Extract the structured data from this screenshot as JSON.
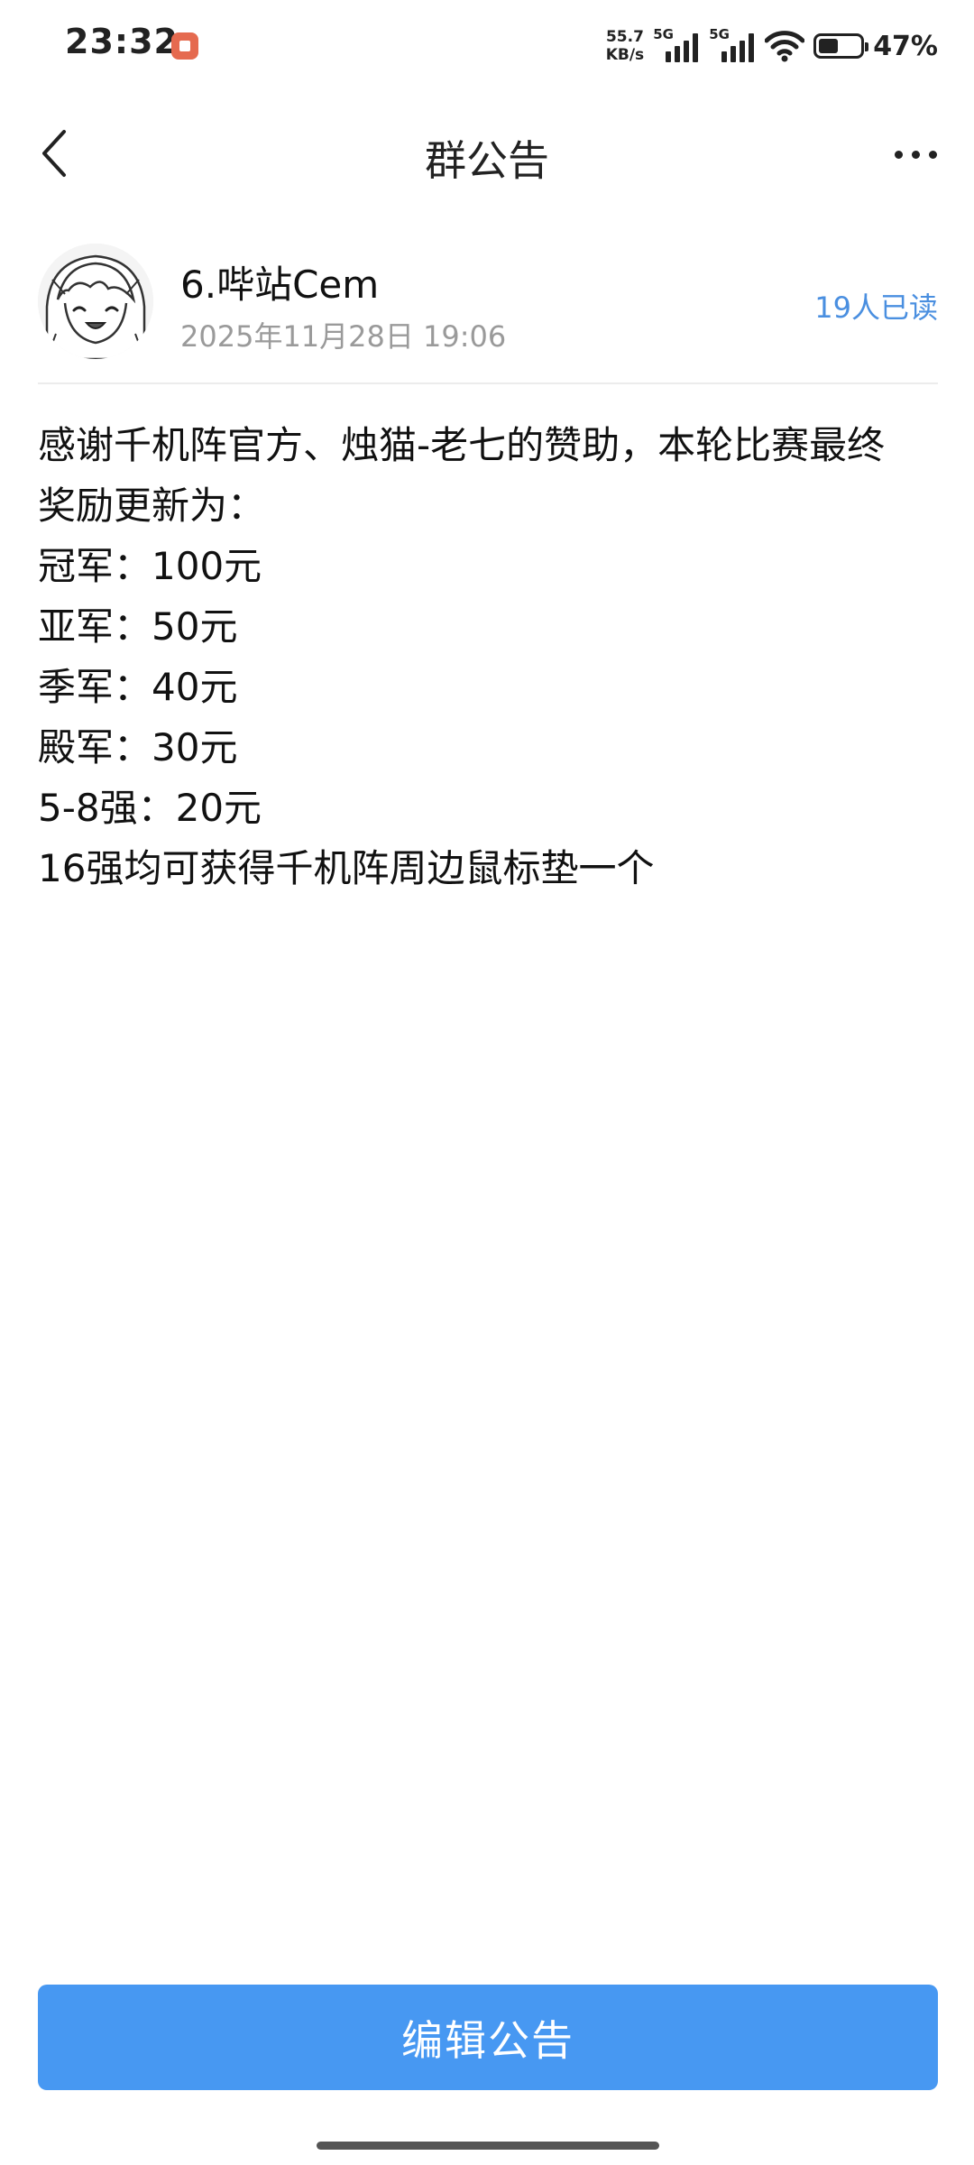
{
  "status_bar": {
    "time": "23:32",
    "net_speed_value": "55.7",
    "net_speed_unit": "KB/s",
    "signal1_label": "5G",
    "signal2_label": "5G",
    "battery_percent": "47%",
    "battery_level": 0.47,
    "notification_icon": "app-notification-icon"
  },
  "nav": {
    "back_icon": "chevron-left-icon",
    "title": "群公告",
    "more_icon": "more-horizontal-icon"
  },
  "announcement": {
    "author_name": "6.哔站Cem",
    "post_time": "2025年11月28日 19:06",
    "read_count": "19人已读",
    "lines": [
      "感谢千机阵官方、烛猫-老七的赞助，本轮比赛最终",
      "奖励更新为：",
      "冠军：100元",
      "亚军：50元",
      "季军：40元",
      "殿军：30元",
      "5-8强：20元",
      "16强均可获得千机阵周边鼠标垫一个"
    ]
  },
  "footer": {
    "edit_button_label": "编辑公告"
  },
  "colors": {
    "accent": "#4798f2",
    "read_count": "#4a8fe0",
    "muted_text": "#9a9a9a"
  }
}
